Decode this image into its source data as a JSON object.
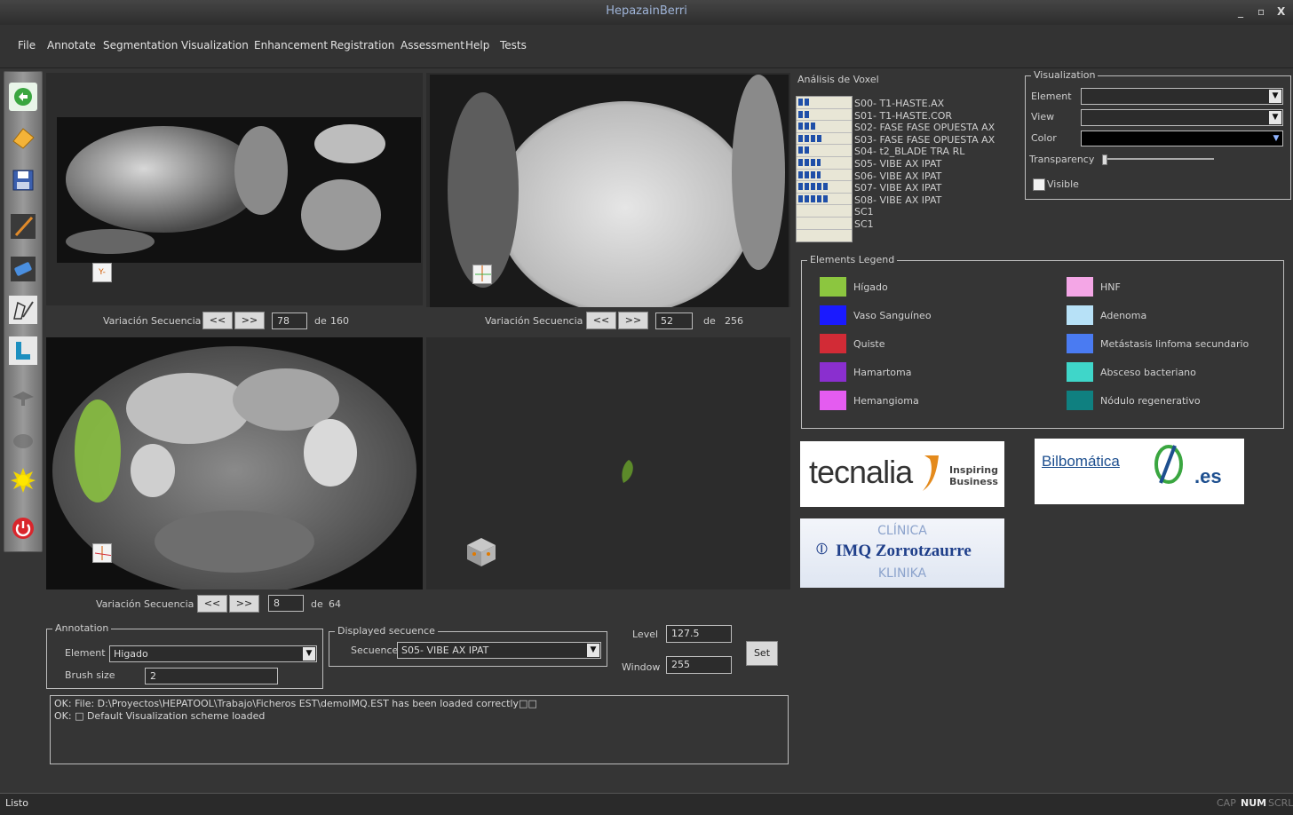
{
  "window": {
    "title": "HepazainBerri",
    "minimize": "_",
    "restore": "▫",
    "close": "X"
  },
  "menu": [
    "File",
    "Annotate",
    "Segmentation",
    "Visualization",
    "Enhancement",
    "Registration",
    "Assessment",
    "Help",
    "Tests"
  ],
  "toolbar_icons": [
    "open-icon",
    "folder-icon",
    "save-icon",
    "brush-icon",
    "eraser-icon",
    "edit-icon",
    "segment-icon",
    "hat-icon",
    "cloud-icon",
    "sun-icon",
    "power-icon"
  ],
  "views": {
    "y": {
      "label": "Variación Secuencia Y",
      "prev": "<<",
      "next": ">>",
      "value": "78",
      "de": "de",
      "max": "160",
      "axis_label": "Y-"
    },
    "x": {
      "label": "Variación Secuencia X",
      "prev": "<<",
      "next": ">>",
      "value": "52",
      "de": "de",
      "max": "256"
    },
    "z": {
      "label": "Variación Secuencia Z",
      "prev": "<<",
      "next": ">>",
      "value": "8",
      "de": "de",
      "max": "64"
    }
  },
  "voxel": {
    "title": "Análisis de Voxel",
    "sequences": [
      {
        "label": "S00- T1-HASTE.AX",
        "level": 0.2
      },
      {
        "label": "S01- T1-HASTE.COR",
        "level": 0.2
      },
      {
        "label": "S02- FASE FASE OPUESTA AX",
        "level": 0.3
      },
      {
        "label": "S03- FASE FASE OPUESTA AX",
        "level": 0.45
      },
      {
        "label": "S04- t2_BLADE TRA RL",
        "level": 0.2
      },
      {
        "label": "S05- VIBE AX IPAT",
        "level": 0.4
      },
      {
        "label": "S06- VIBE AX IPAT",
        "level": 0.4
      },
      {
        "label": "S07- VIBE AX IPAT",
        "level": 0.55
      },
      {
        "label": "S08- VIBE AX IPAT",
        "level": 0.55
      },
      {
        "label": "SC1",
        "level": 0
      },
      {
        "label": "SC1",
        "level": 0
      }
    ]
  },
  "visualization": {
    "title": "Visualization",
    "element_label": "Element",
    "element_value": "",
    "view_label": "View",
    "view_value": "",
    "color_label": "Color",
    "color_value": "#000000",
    "transparency_label": "Transparency",
    "transparency": 0.0,
    "visible_label": "Visible",
    "visible": false
  },
  "legend": {
    "title": "Elements Legend",
    "items": [
      {
        "label": "Hígado",
        "color": "#8cc63f"
      },
      {
        "label": "HNF",
        "color": "#f4a6e6"
      },
      {
        "label": "Vaso Sanguíneo",
        "color": "#1a1aff"
      },
      {
        "label": "Adenoma",
        "color": "#b7e1f7"
      },
      {
        "label": "Quiste",
        "color": "#d22b36"
      },
      {
        "label": "Metástasis linfoma secundario",
        "color": "#4a7bf2"
      },
      {
        "label": "Hamartoma",
        "color": "#8a2fcf"
      },
      {
        "label": "Absceso bacteriano",
        "color": "#3fd6c9"
      },
      {
        "label": "Hemangioma",
        "color": "#e45cf0"
      },
      {
        "label": "Nódulo regenerativo",
        "color": "#0f8080"
      }
    ]
  },
  "logos": {
    "tecnalia": "tecnalia",
    "tecnalia_tag1": "Inspiring",
    "tecnalia_tag2": "Business",
    "bilbomatica": "Bilbomática",
    "bilbomatica_tld": ".es",
    "imq_top": "CLÍNICA",
    "imq_main": "IMQ Zorrotzaurre",
    "imq_bottom": "KLINIKA"
  },
  "annotation": {
    "title": "Annotation",
    "element_label": "Element",
    "element_value": "Higado",
    "brush_label": "Brush size",
    "brush_value": "2"
  },
  "displayed": {
    "title": "Displayed secuence",
    "secuence_label": "Secuence",
    "secuence_value": "S05- VIBE AX IPAT"
  },
  "window_level": {
    "level_label": "Level",
    "level_value": "127.5",
    "window_label": "Window",
    "window_value": "255",
    "set": "Set"
  },
  "log": [
    "OK: File: D:\\Proyectos\\HEPATOOL\\Trabajo\\Ficheros EST\\demoIMQ.EST has been loaded correctly□□",
    "OK: □ Default Visualization scheme loaded"
  ],
  "status": {
    "text": "Listo",
    "cap": "CAP",
    "num": "NUM",
    "scrl": "SCRL"
  }
}
